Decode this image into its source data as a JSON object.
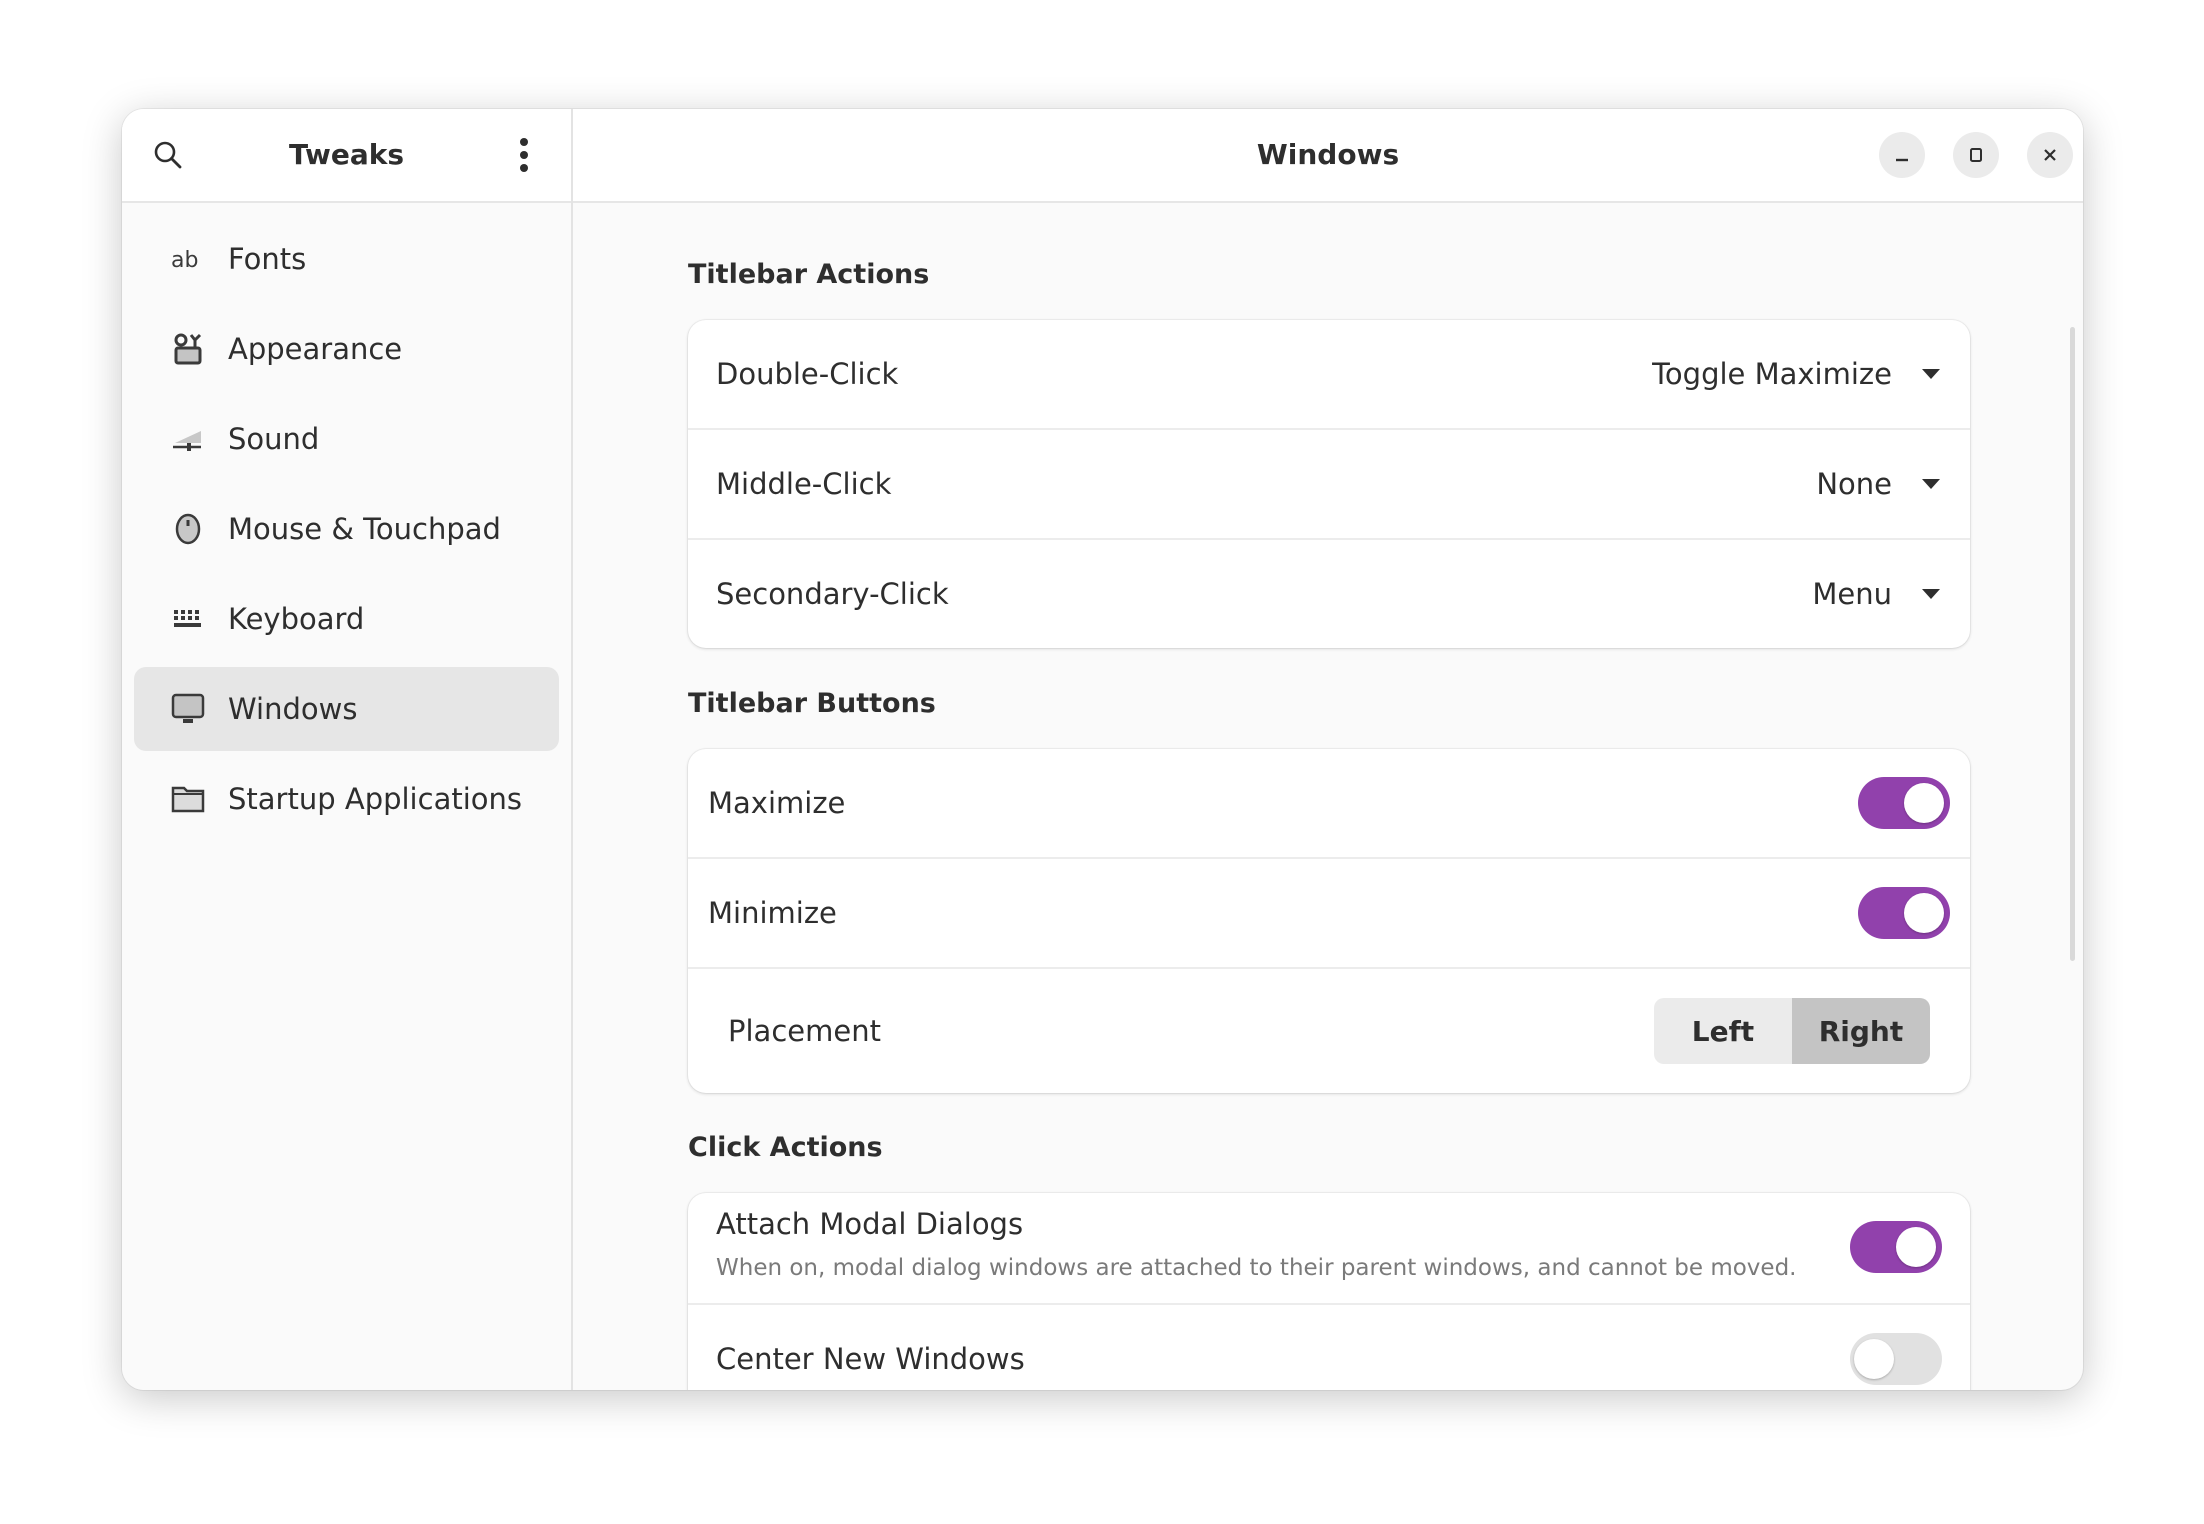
{
  "sidebar": {
    "title": "Tweaks",
    "search_icon": "search-icon",
    "menu_icon": "kebab-menu-icon",
    "items": [
      {
        "label": "Fonts",
        "icon": "fonts-icon",
        "active": false
      },
      {
        "label": "Appearance",
        "icon": "appearance-icon",
        "active": false
      },
      {
        "label": "Sound",
        "icon": "sound-icon",
        "active": false
      },
      {
        "label": "Mouse & Touchpad",
        "icon": "mouse-icon",
        "active": false
      },
      {
        "label": "Keyboard",
        "icon": "keyboard-icon",
        "active": false
      },
      {
        "label": "Windows",
        "icon": "monitor-icon",
        "active": true
      },
      {
        "label": "Startup Applications",
        "icon": "folder-icon",
        "active": false
      }
    ]
  },
  "content": {
    "title": "Windows",
    "window_controls": [
      "minimize",
      "maximize",
      "close"
    ],
    "accent_color": "#9141ac",
    "sections": {
      "titlebar_actions": {
        "title": "Titlebar Actions",
        "rows": [
          {
            "label": "Double-Click",
            "value": "Toggle Maximize"
          },
          {
            "label": "Middle-Click",
            "value": "None"
          },
          {
            "label": "Secondary-Click",
            "value": "Menu"
          }
        ]
      },
      "titlebar_buttons": {
        "title": "Titlebar Buttons",
        "rows": [
          {
            "label": "Maximize",
            "on": true
          },
          {
            "label": "Minimize",
            "on": true
          }
        ],
        "placement": {
          "label": "Placement",
          "options": [
            "Left",
            "Right"
          ],
          "selected": "Right"
        }
      },
      "click_actions": {
        "title": "Click Actions",
        "rows": [
          {
            "label": "Attach Modal Dialogs",
            "subtitle": "When on, modal dialog windows are attached to their parent windows, and cannot be moved.",
            "on": true
          },
          {
            "label": "Center New Windows",
            "on": false
          }
        ]
      }
    }
  }
}
